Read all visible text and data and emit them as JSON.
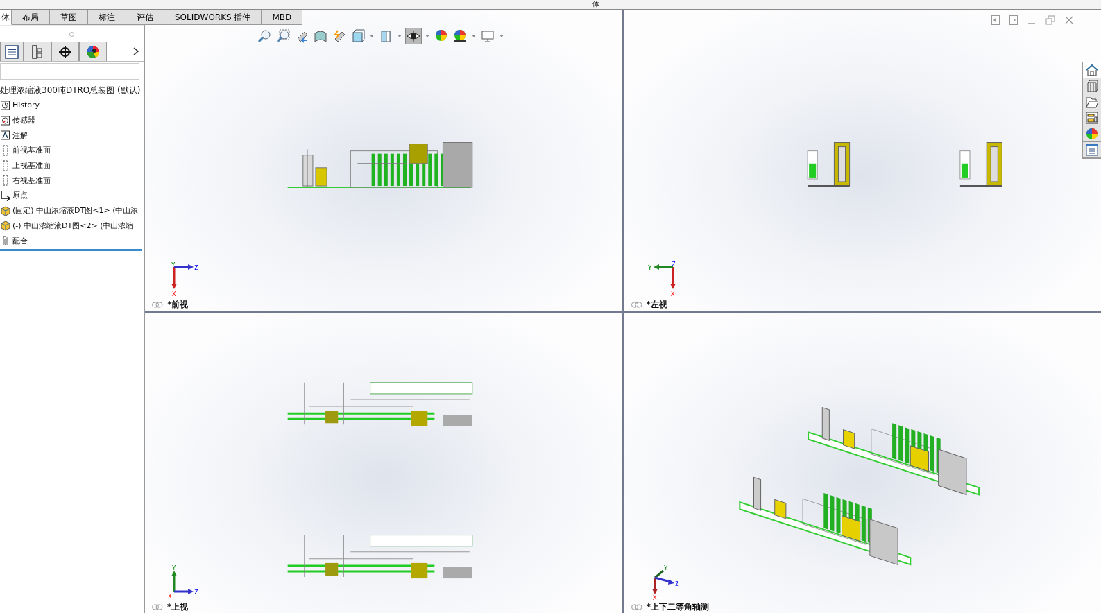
{
  "top_strip": {
    "text": "体"
  },
  "command_tabs": [
    {
      "label": "体",
      "selected": true
    },
    {
      "label": "布局",
      "selected": false
    },
    {
      "label": "草图",
      "selected": false
    },
    {
      "label": "标注",
      "selected": false
    },
    {
      "label": "评估",
      "selected": false
    },
    {
      "label": "SOLIDWORKS 插件",
      "selected": false
    },
    {
      "label": "MBD",
      "selected": false
    }
  ],
  "manager_tabs": [
    {
      "kind": "tree",
      "selected": false
    },
    {
      "kind": "property",
      "selected": false
    },
    {
      "kind": "config",
      "selected": false
    },
    {
      "kind": "display",
      "selected": false
    }
  ],
  "tree": {
    "root": "处理浓缩液300吨DTRO总装图 (默认)",
    "items": [
      {
        "kind": "history",
        "label": "History"
      },
      {
        "kind": "sensor",
        "label": "传感器"
      },
      {
        "kind": "annotation",
        "label": "注解"
      },
      {
        "kind": "plane",
        "label": "前视基准面"
      },
      {
        "kind": "plane",
        "label": "上视基准面"
      },
      {
        "kind": "plane",
        "label": "右视基准面"
      },
      {
        "kind": "origin",
        "label": "原点"
      },
      {
        "kind": "part",
        "label": "(固定) 中山浓缩液DT图<1> (中山浓"
      },
      {
        "kind": "part",
        "label": "(-) 中山浓缩液DT图<2> (中山浓缩"
      },
      {
        "kind": "mate",
        "label": "配合"
      }
    ]
  },
  "view_toolbar": [
    {
      "kind": "zoom-fit",
      "dropdown": false,
      "selected": false
    },
    {
      "kind": "zoom-area",
      "dropdown": false,
      "selected": false
    },
    {
      "kind": "previous",
      "dropdown": false,
      "selected": false
    },
    {
      "kind": "section",
      "dropdown": false,
      "selected": false
    },
    {
      "kind": "dynamic",
      "dropdown": false,
      "selected": false
    },
    {
      "kind": "orientation",
      "dropdown": true,
      "selected": false
    },
    {
      "kind": "display-style",
      "dropdown": true,
      "selected": false
    },
    {
      "kind": "hide-show",
      "dropdown": true,
      "selected": true
    },
    {
      "kind": "edit-appearance",
      "dropdown": false,
      "selected": false
    },
    {
      "kind": "scene",
      "dropdown": true,
      "selected": false
    },
    {
      "kind": "view-settings",
      "dropdown": true,
      "selected": false
    }
  ],
  "task_pane": [
    {
      "kind": "home",
      "selected": true
    },
    {
      "kind": "library",
      "selected": false
    },
    {
      "kind": "folder",
      "selected": false
    },
    {
      "kind": "palette",
      "selected": false
    },
    {
      "kind": "appearance",
      "selected": false
    },
    {
      "kind": "properties",
      "selected": false
    }
  ],
  "viewports": [
    {
      "kind": "front",
      "label": "*前视",
      "axis_labels": {
        "x": "X",
        "y": "Y",
        "z": "Z"
      }
    },
    {
      "kind": "left",
      "label": "*左视",
      "axis_labels": {
        "x": "X",
        "y": "Y",
        "z": "Z"
      }
    },
    {
      "kind": "top",
      "label": "*上视",
      "axis_labels": {
        "x": "X",
        "y": "Y",
        "z": "Z"
      }
    },
    {
      "kind": "iso",
      "label": "*上下二等角轴测",
      "axis_labels": {
        "x": "X",
        "y": "Y",
        "z": "Z"
      }
    }
  ]
}
